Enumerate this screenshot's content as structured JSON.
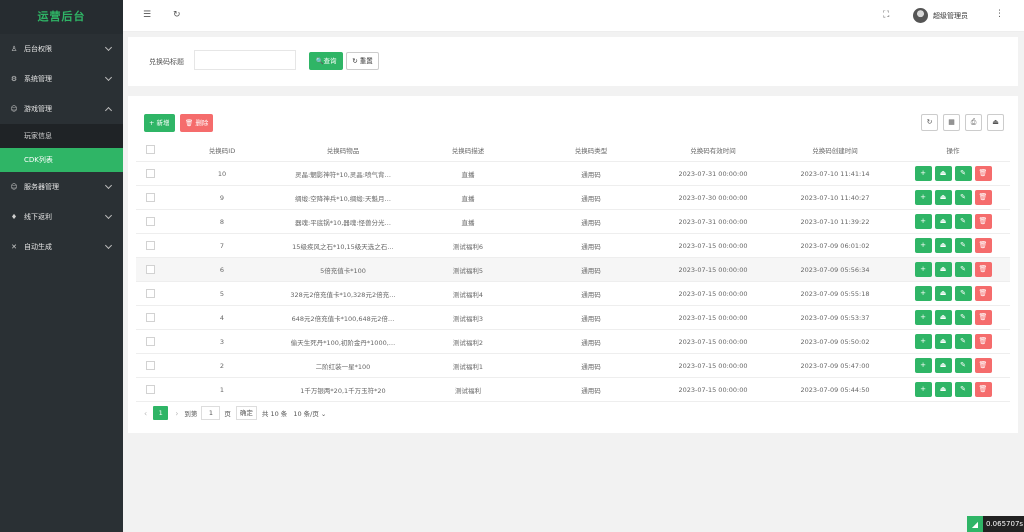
{
  "app": {
    "title": "运营后台"
  },
  "sidebar": {
    "items": [
      {
        "label": "后台权限",
        "icon": "user-icon",
        "glyph": "♙"
      },
      {
        "label": "系统管理",
        "icon": "gear-icon",
        "glyph": "⚙"
      },
      {
        "label": "游戏管理",
        "icon": "smile-icon",
        "glyph": "☺",
        "expanded": true,
        "children": [
          {
            "label": "玩家信息"
          },
          {
            "label": "CDK列表",
            "active": true
          }
        ]
      },
      {
        "label": "服务器管理",
        "icon": "smile-icon",
        "glyph": "☺"
      },
      {
        "label": "线下返利",
        "icon": "diamond-icon",
        "glyph": "♦"
      },
      {
        "label": "自动生成",
        "icon": "code-icon",
        "glyph": "✕"
      }
    ]
  },
  "header": {
    "menu_glyph": "☰",
    "refresh_glyph": "↻",
    "fullscreen_glyph": "⛶",
    "more_glyph": "⋮",
    "user_name": "超级管理员"
  },
  "search": {
    "label": "兑换码标题",
    "input_value": "",
    "query_label": "🔍查询",
    "reset_label": "↻ 重置"
  },
  "toolbar": {
    "add_label": "+ 新增",
    "delete_label": "🗑 删除",
    "right_icons": [
      {
        "name": "refresh-icon",
        "glyph": "↻"
      },
      {
        "name": "columns-icon",
        "glyph": "▦"
      },
      {
        "name": "print-icon",
        "glyph": "⎙"
      },
      {
        "name": "export-icon",
        "glyph": "⏏"
      }
    ]
  },
  "table": {
    "headers": [
      "兑换码ID",
      "兑换码物品",
      "兑换码描述",
      "兑换码类型",
      "兑换码有效时间",
      "兑换码创建时间",
      "操作"
    ],
    "rows": [
      {
        "id": "10",
        "item": "灵晶:魍影神符*10,灵晶:喷气背…",
        "desc": "直播",
        "type": "通用码",
        "valid": "2023-07-31 00:00:00",
        "created": "2023-07-10 11:41:14"
      },
      {
        "id": "9",
        "item": "绸缎:空降神兵*10,绸缎:天魁月…",
        "desc": "直播",
        "type": "通用码",
        "valid": "2023-07-30 00:00:00",
        "created": "2023-07-10 11:40:27"
      },
      {
        "id": "8",
        "item": "器魂:平底锅*10,器魂:怪兽分光…",
        "desc": "直播",
        "type": "通用码",
        "valid": "2023-07-31 00:00:00",
        "created": "2023-07-10 11:39:22"
      },
      {
        "id": "7",
        "item": "15级疾风之石*10,15级天选之石…",
        "desc": "测试福利6",
        "type": "通用码",
        "valid": "2023-07-15 00:00:00",
        "created": "2023-07-09 06:01:02"
      },
      {
        "id": "6",
        "item": "5倍充值卡*100",
        "desc": "测试福利5",
        "type": "通用码",
        "valid": "2023-07-15 00:00:00",
        "created": "2023-07-09 05:56:34"
      },
      {
        "id": "5",
        "item": "328元2倍充值卡*10,328元2倍充…",
        "desc": "测试福利4",
        "type": "通用码",
        "valid": "2023-07-15 00:00:00",
        "created": "2023-07-09 05:55:18"
      },
      {
        "id": "4",
        "item": "648元2倍充值卡*100,648元2倍…",
        "desc": "测试福利3",
        "type": "通用码",
        "valid": "2023-07-15 00:00:00",
        "created": "2023-07-09 05:53:37"
      },
      {
        "id": "3",
        "item": "偷天生死丹*100,初阶金丹*1000,…",
        "desc": "测试福利2",
        "type": "通用码",
        "valid": "2023-07-15 00:00:00",
        "created": "2023-07-09 05:50:02"
      },
      {
        "id": "2",
        "item": "二阶红装一星*100",
        "desc": "测试福利1",
        "type": "通用码",
        "valid": "2023-07-15 00:00:00",
        "created": "2023-07-09 05:47:00"
      },
      {
        "id": "1",
        "item": "1千万银两*20,1千万玉符*20",
        "desc": "测试福利",
        "type": "通用码",
        "valid": "2023-07-15 00:00:00",
        "created": "2023-07-09 05:44:50"
      }
    ],
    "ops": [
      {
        "name": "add-op-icon",
        "glyph": "+",
        "color": "g"
      },
      {
        "name": "export-op-icon",
        "glyph": "⏏",
        "color": "g"
      },
      {
        "name": "edit-op-icon",
        "glyph": "✎",
        "color": "g"
      },
      {
        "name": "delete-op-icon",
        "glyph": "🗑",
        "color": "r"
      }
    ]
  },
  "pagination": {
    "prev": "‹",
    "next": "›",
    "current": "1",
    "goto_label": "到第",
    "goto_value": "1",
    "page_unit": "页",
    "confirm_label": "确定",
    "total_label": "共 10 条",
    "page_size": "10 条/页 ⌄"
  },
  "footer": {
    "timer": "0.065707s"
  },
  "colors": {
    "accent": "#2fb566",
    "danger": "#f56c6c",
    "sidebar": "#2a3034"
  }
}
